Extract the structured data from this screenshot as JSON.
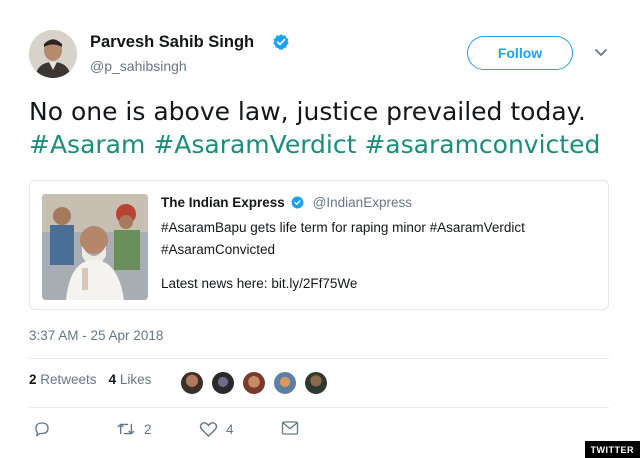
{
  "author": {
    "display_name": "Parvesh Sahib Singh",
    "handle": "@p_sahibsingh",
    "verified": true
  },
  "follow_label": "Follow",
  "tweet": {
    "text_plain": "No one is above law, justice prevailed today.",
    "hashtags": [
      "#Asaram",
      "#AsaramVerdict",
      "#asaramconvicted"
    ]
  },
  "quoted_card": {
    "source_name": "The Indian Express",
    "source_handle": "@IndianExpress",
    "line1": "#AsaramBapu gets life term for raping minor #AsaramVerdict",
    "line2": "#AsaramConvicted",
    "line3": "Latest news here: bit.ly/2Ff75We"
  },
  "timestamp": "3:37 AM - 25 Apr 2018",
  "stats": {
    "retweets_count": "2",
    "retweets_label": "Retweets",
    "likes_count": "4",
    "likes_label": "Likes"
  },
  "actions": {
    "retweet_count": "2",
    "like_count": "4"
  },
  "watermark": "TWITTER",
  "colors": {
    "link_blue": "#1da1f2",
    "hashtag_teal": "#1b8d7a",
    "muted": "#657786",
    "border": "#e1e8ed"
  },
  "icons": [
    "verified-badge-icon",
    "chevron-down-icon",
    "reply-icon",
    "retweet-icon",
    "like-icon",
    "message-icon"
  ]
}
